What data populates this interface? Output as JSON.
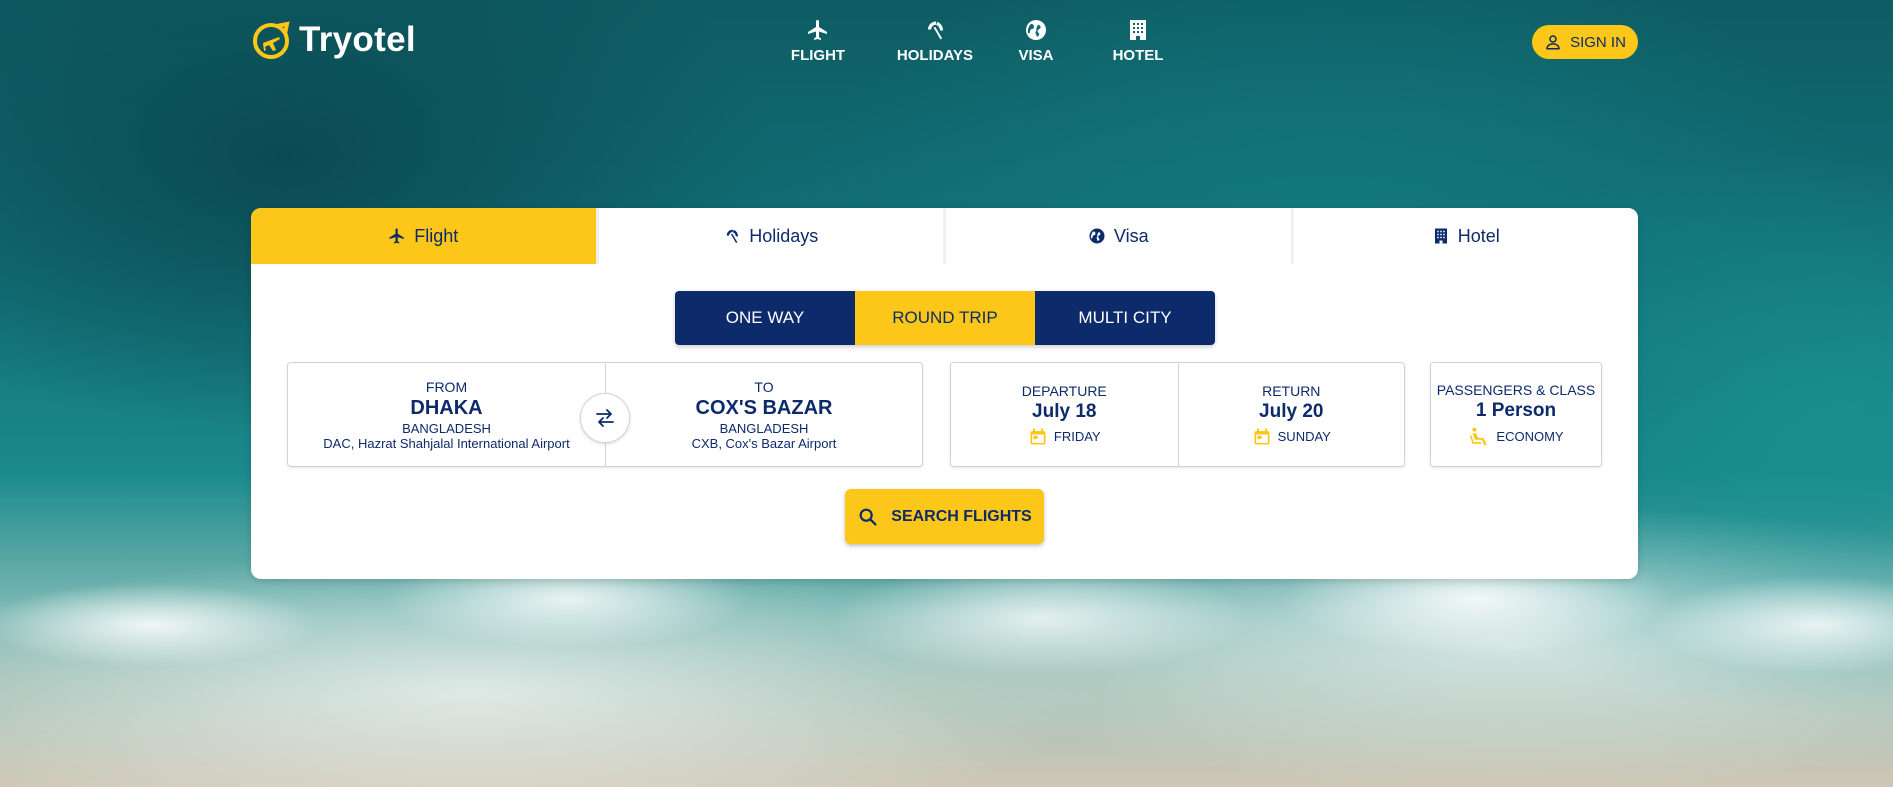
{
  "brand": {
    "name": "Tryotel"
  },
  "nav": {
    "items": [
      {
        "label": "FLIGHT",
        "icon": "plane-icon"
      },
      {
        "label": "HOLIDAYS",
        "icon": "beach-umbrella-icon"
      },
      {
        "label": "VISA",
        "icon": "globe-icon"
      },
      {
        "label": "HOTEL",
        "icon": "building-icon"
      }
    ],
    "sign_in": "SIGN IN"
  },
  "tabs": [
    {
      "label": "Flight",
      "active": true
    },
    {
      "label": "Holidays",
      "active": false
    },
    {
      "label": "Visa",
      "active": false
    },
    {
      "label": "Hotel",
      "active": false
    }
  ],
  "trip_types": [
    {
      "label": "ONE WAY",
      "active": false
    },
    {
      "label": "ROUND TRIP",
      "active": true
    },
    {
      "label": "MULTI CITY",
      "active": false
    }
  ],
  "from": {
    "caption": "FROM",
    "city": "DHAKA",
    "country": "BANGLADESH",
    "airport": "DAC, Hazrat Shahjalal International Airport"
  },
  "to": {
    "caption": "TO",
    "city": "COX'S BAZAR",
    "country": "BANGLADESH",
    "airport": "CXB, Cox's Bazar Airport"
  },
  "departure": {
    "caption": "DEPARTURE",
    "date": "July 18",
    "weekday": "FRIDAY"
  },
  "return": {
    "caption": "RETURN",
    "date": "July 20",
    "weekday": "SUNDAY"
  },
  "passengers": {
    "caption": "PASSENGERS & CLASS",
    "count": "1 Person",
    "class": "ECONOMY"
  },
  "search_button": "SEARCH FLIGHTS",
  "colors": {
    "primary": "#0d2a6b",
    "accent": "#fcc718"
  }
}
